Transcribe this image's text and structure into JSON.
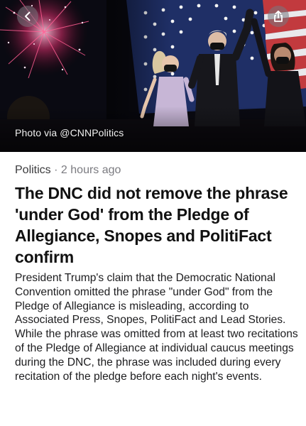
{
  "hero": {
    "back_icon": "chevron-left-icon",
    "share_icon": "share-icon",
    "caption": "Photo via @CNNPolitics"
  },
  "article": {
    "category": "Politics",
    "separator": "·",
    "time_ago": "2 hours ago",
    "headline": "The DNC did not remove the phrase 'under God' from the Pledge of Allegiance, Snopes and PolitiFact confirm",
    "summary": "President Trump's claim that the Democratic National Convention omitted the phrase \"under God\" from the Pledge of Allegiance is misleading, according to Associated Press, Snopes, PolitiFact and Lead Stories. While the phrase was omitted from at least two recitations of the Pledge of Allegiance at individual caucus meetings during the DNC, the phrase was included during every recitation of the pledge before each night's events."
  },
  "colors": {
    "meta_text": "#7b7b80",
    "headline_text": "#111111",
    "body_text": "#1c1c1e",
    "hero_background": "#07070d"
  }
}
